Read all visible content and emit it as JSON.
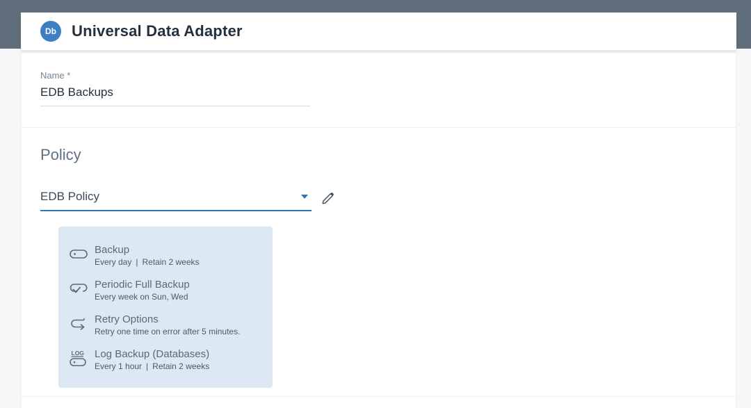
{
  "header": {
    "badge": "Db",
    "title": "Universal Data Adapter"
  },
  "form": {
    "name_label": "Name *",
    "name_value": "EDB Backups"
  },
  "policy": {
    "heading": "Policy",
    "selected_value": "EDB Policy",
    "items": [
      {
        "icon": "backup-icon",
        "title": "Backup",
        "subtitle": "Every day | Retain 2 weeks"
      },
      {
        "icon": "periodic-full-backup-icon",
        "title": "Periodic Full Backup",
        "subtitle": "Every week on Sun, Wed"
      },
      {
        "icon": "retry-options-icon",
        "title": "Retry Options",
        "subtitle": "Retry one time on error after 5 minutes."
      },
      {
        "icon": "log-backup-icon",
        "title": "Log Backup (Databases)",
        "subtitle": "Every 1 hour | Retain 2 weeks"
      }
    ]
  },
  "colors": {
    "topbar": "#5f6e7a",
    "accent_blue": "#3173b5",
    "badge_blue": "#3e7fc1",
    "card_bg": "#dce8f4"
  }
}
